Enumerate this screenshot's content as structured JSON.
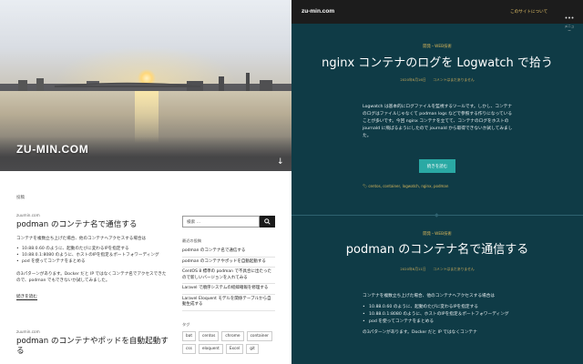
{
  "left": {
    "site_title": "ZU-MIN.COM",
    "section_label": "投稿",
    "posts": [
      {
        "date": "zuumin.com",
        "title": "podman のコンテナ名で通信する",
        "desc": "コンテナを複数立ち上げた場合、他のコンテナへアクセスする場合は",
        "bullets": [
          "10.88.0.60 のように、起動のたびに変わるIPを指定する",
          "10.88.0.1:8080 のように、ホストのIPを指定＆ポートフォワーディング",
          "pod を使ってコンテナをまとめる"
        ],
        "desc2": "の3パターンがあります。Docker だと IP ではなくコンテナ名でアクセスできたので、podman でもできないか試してみました。",
        "more": "続きを読む"
      },
      {
        "date": "zuumin.com",
        "title": "podman のコンテナやポッドを自動起動する"
      }
    ],
    "sidebar": {
      "search_placeholder": "検索 …",
      "recent_label": "最近の投稿",
      "recent": [
        "podman のコンテナ名で通信する",
        "podman のコンテナやポッドを自動起動する",
        "CentOS 8 標準の podman で不具合に出たったので新しいバージョンを入れてみる",
        "Laravel で順序システムの経緯確報を修理する",
        "Laravel Eloquent モデルを関係テーブルから自動生成する"
      ],
      "tags_label": "タグ",
      "tags": [
        "bat",
        "centos",
        "chrome",
        "container",
        "css",
        "eloquent",
        "Excel",
        "git"
      ]
    }
  },
  "right": {
    "brand": "zu-min.com",
    "about": "このサイトについて",
    "menu_label": "メニュー",
    "article1": {
      "category": "開発・WEB技術",
      "title": "nginx コンテナのログを Logwatch で拾う",
      "meta": "2020年6月16日　　コメントはまだありません",
      "body": "Logwatch は基本的にログファイルを監視するツールです。しかし、コンテナのログはファイルじゃなくて podman logs などで参照する作りになっていることが多いです。今回 nginx コンテナを立てて、コンテナのログをホストの journald に飛ばるようにしたので journald から取得できないか試してみました。",
      "readmore": "続きを読む",
      "tags": "centos, container, logwatch, nginx, podman"
    },
    "article2": {
      "category": "開発・WEB技術",
      "title": "podman のコンテナ名で通信する",
      "meta": "2020年6月11日　　コメントはまだありません",
      "body": "コンテナを複数立ち上げた場合、他のコンテナへアクセスする場合は",
      "bullets": [
        "10.88.0.60 のように、起動のたびに変わるIPを指定する",
        "10.88.0.1:8080 のように、ホストのIPを指定＆ポートフォワーディング",
        "pod を使ってコンテナをまとめる"
      ],
      "body2": "の3パターンがあります。Docker だと IP ではなくコンテナ"
    }
  },
  "colors": {
    "teal_bg": "#0f3b46",
    "accent_gold": "#d9b75a",
    "button_teal": "#2aa9a4",
    "topbar": "#1c1c1c"
  }
}
